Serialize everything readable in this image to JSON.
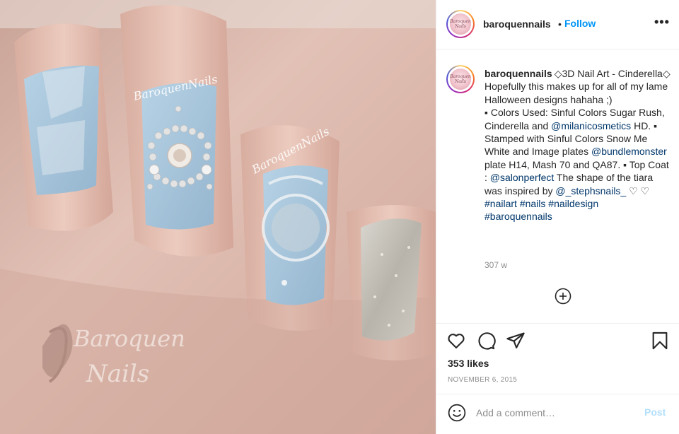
{
  "photo": {
    "watermark_top_left": "BaroquenNails",
    "watermark_top_right": "BaroquenNails",
    "logo_line1": "Baroquen",
    "logo_line2": "Nails"
  },
  "header": {
    "username": "baroquennails",
    "separator": "•",
    "follow_label": "Follow",
    "more_label": "•••",
    "avatar_text": "Baroquen Nails"
  },
  "caption": {
    "username": "baroquennails",
    "segments": [
      {
        "text": "◇3D Nail Art - Cinderella◇",
        "link": false
      },
      {
        "text": "Hopefully this makes up for all of my lame Halloween designs hahaha ;)",
        "link": false,
        "br": true
      },
      {
        "text": "▪ Colors Used: Sinful Colors Sugar Rush, Cinderella and ",
        "link": false,
        "br": true
      },
      {
        "text": "@milanicosmetics",
        "link": true
      },
      {
        "text": " HD. ▪ Stamped with Sinful Colors Snow Me White and Image plates ",
        "link": false
      },
      {
        "text": "@bundlemonster",
        "link": true
      },
      {
        "text": " plate H14, Mash 70 and QA87. ▪ Top Coat : ",
        "link": false
      },
      {
        "text": "@salonperfect",
        "link": true
      },
      {
        "text": " The shape of the tiara was inspired by ",
        "link": false
      },
      {
        "text": "@_stephsnails_",
        "link": true
      },
      {
        "text": " ♡ ♡",
        "link": false
      },
      {
        "text": "#nailart",
        "link": true,
        "br": true
      },
      {
        "text": " ",
        "link": false
      },
      {
        "text": "#nails",
        "link": true
      },
      {
        "text": " ",
        "link": false
      },
      {
        "text": "#naildesign",
        "link": true
      },
      {
        "text": "#baroquennails",
        "link": true,
        "br": true
      }
    ],
    "time_ago": "307 w"
  },
  "actions": {
    "icons": [
      "heart-icon",
      "comment-icon",
      "share-icon",
      "bookmark-icon"
    ],
    "likes": "353 likes",
    "date": "NOVEMBER 6, 2015"
  },
  "comment": {
    "placeholder": "Add a comment…",
    "post_label": "Post"
  },
  "colors": {
    "link": "#00376b",
    "follow": "#0095f6",
    "post_disabled": "#b2dffc",
    "muted": "#8e8e8e",
    "nail_blue": "#a9c7dc",
    "skin": "#dcb8ac"
  }
}
